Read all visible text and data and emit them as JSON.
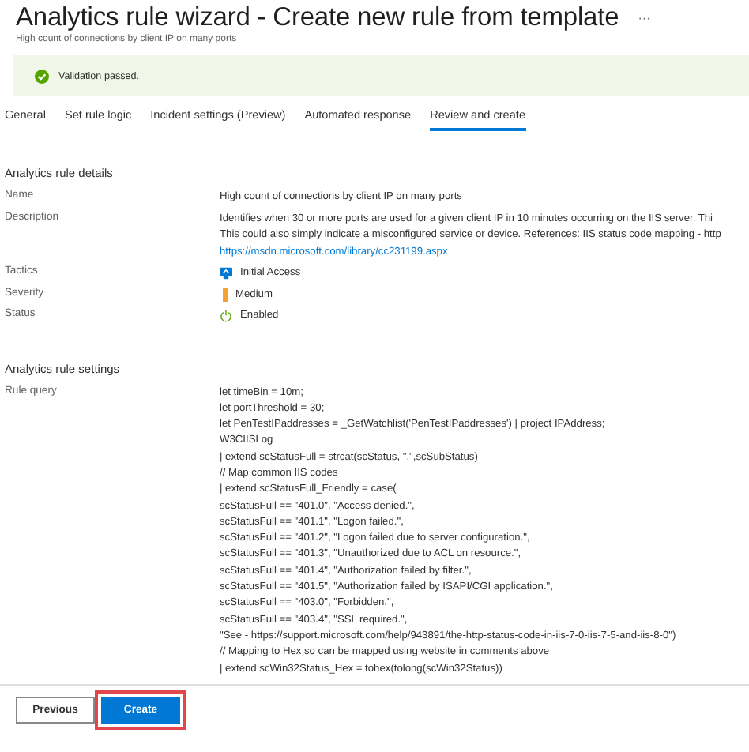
{
  "header": {
    "title": "Analytics rule wizard - Create new rule from template",
    "more": "···",
    "subtitle": "High count of connections by client IP on many ports"
  },
  "validation": {
    "passed": true,
    "message": "Validation passed."
  },
  "tabs": [
    {
      "label": "General",
      "selected": false
    },
    {
      "label": "Set rule logic",
      "selected": false
    },
    {
      "label": "Incident settings (Preview)",
      "selected": false
    },
    {
      "label": "Automated response",
      "selected": false
    },
    {
      "label": "Review and create",
      "selected": true
    }
  ],
  "details": {
    "heading": "Analytics rule details",
    "rows": [
      {
        "kind": "text",
        "label": "Name",
        "lines": [
          {
            "text": "High count of connections by client IP on many ports",
            "link": false
          }
        ]
      },
      {
        "kind": "text",
        "label": "Description",
        "lines": [
          {
            "text": "Identifies when 30 or more ports are used for a given client IP in 10 minutes occurring on the IIS server. Thi",
            "link": false
          },
          {
            "text": "This could also simply indicate a misconfigured service or device. References: IIS status code mapping - http",
            "link": false
          },
          {
            "text": "https://msdn.microsoft.com/library/cc231199.aspx",
            "link": true
          }
        ]
      },
      {
        "kind": "tactic",
        "label": "Tactics",
        "lines": [
          {
            "text": "Initial Access",
            "link": false
          }
        ]
      },
      {
        "kind": "severity",
        "label": "Severity",
        "color": "#f7a135",
        "lines": [
          {
            "text": "Medium",
            "link": false
          }
        ]
      },
      {
        "kind": "status",
        "label": "Status",
        "lines": [
          {
            "text": "Enabled",
            "link": false
          }
        ]
      }
    ]
  },
  "settings": {
    "heading": "Analytics rule settings",
    "label": "Rule query",
    "query": [
      "let timeBin = 10m;",
      "let portThreshold = 30;",
      "let PenTestIPaddresses = _GetWatchlist('PenTestIPaddresses') | project IPAddress;",
      "W3CIISLog",
      "| extend scStatusFull = strcat(scStatus, \".\",scSubStatus)",
      "// Map common IIS codes",
      "| extend scStatusFull_Friendly = case(",
      "scStatusFull == \"401.0\", \"Access denied.\",",
      "scStatusFull == \"401.1\", \"Logon failed.\",",
      "scStatusFull == \"401.2\", \"Logon failed due to server configuration.\",",
      "scStatusFull == \"401.3\", \"Unauthorized due to ACL on resource.\",",
      "scStatusFull == \"401.4\", \"Authorization failed by filter.\",",
      "scStatusFull == \"401.5\", \"Authorization failed by ISAPI/CGI application.\",",
      "scStatusFull == \"403.0\", \"Forbidden.\",",
      "scStatusFull == \"403.4\", \"SSL required.\",",
      "\"See - https://support.microsoft.com/help/943891/the-http-status-code-in-iis-7-0-iis-7-5-and-iis-8-0\")",
      "// Mapping to Hex so can be mapped using website in comments above",
      "| extend scWin32Status_Hex = tohex(tolong(scWin32Status))"
    ]
  },
  "buttons": [
    {
      "label": "Previous",
      "kind": "secondary",
      "highlighted": false
    },
    {
      "label": "Create",
      "kind": "primary",
      "highlighted": true
    }
  ]
}
